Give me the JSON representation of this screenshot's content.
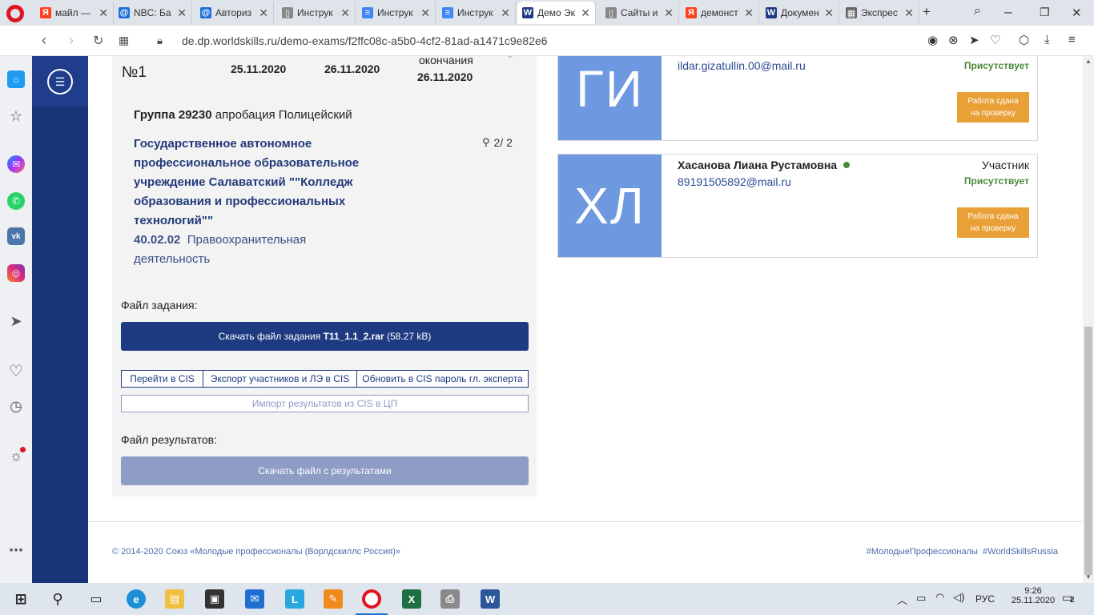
{
  "browser": {
    "tabs": [
      {
        "label": "майл —",
        "favicon_char": "Я",
        "favicon_color": "#fc3f1d"
      },
      {
        "label": "NBC: Ба",
        "favicon_char": "@",
        "favicon_color": "#1e6fd9"
      },
      {
        "label": "Авториз",
        "favicon_char": "@",
        "favicon_color": "#1e6fd9"
      },
      {
        "label": "Инструк",
        "favicon_char": "▯",
        "favicon_color": "#888888"
      },
      {
        "label": "Инструк",
        "favicon_char": "≡",
        "favicon_color": "#4285f4"
      },
      {
        "label": "Инструк",
        "favicon_char": "≡",
        "favicon_color": "#4285f4"
      },
      {
        "label": "Демо Эк",
        "favicon_char": "W",
        "favicon_color": "#1e3a80"
      },
      {
        "label": "Сайты и",
        "favicon_char": "▯",
        "favicon_color": "#888888"
      },
      {
        "label": "демонст",
        "favicon_char": "Я",
        "favicon_color": "#fc3f1d"
      },
      {
        "label": "Докумен",
        "favicon_char": "W",
        "favicon_color": "#1e3a80"
      },
      {
        "label": "Экспрес",
        "favicon_char": "▦",
        "favicon_color": "#666666"
      }
    ],
    "url": "de.dp.worldskills.ru/demo-exams/f2ffc08c-a5b0-4cf2-81ad-a1471c9e82e6"
  },
  "exam": {
    "number": "№1",
    "start_date": "25.11.2020",
    "end_date": "26.11.2020",
    "end_label": "окончания",
    "end_date_2": "26.11.2020",
    "group_label": "Группа 29230",
    "group_desc": "апробация Полицейский",
    "institution": "Государственное автономное профессиональное образовательное учреждение Салаватский \"\"Колледж образования и профессиональных технологий\"\"",
    "participants_count": "2/ 2",
    "spec_code": "40.02.02",
    "spec_name": "Правоохранительная деятельность",
    "task_file_label": "Файл задания:",
    "download_task_prefix": "Скачать файл задания",
    "download_task_file": "T11_1.1_2.rar",
    "download_task_size": "(58.27 kB)",
    "btn_cis": "Перейти в CIS",
    "btn_export": "Экспорт участников и ЛЭ в CIS",
    "btn_update_pwd": "Обновить в CIS пароль гл. эксперта",
    "btn_import": "Импорт результатов из CIS в ЦП",
    "results_file_label": "Файл результатов:",
    "btn_download_results": "Скачать файл с результатами"
  },
  "participants": [
    {
      "initials": "ГИ",
      "name": "",
      "email": "ildar.gizatullin.00@mail.ru",
      "role": "",
      "status": "Присутствует",
      "work_btn_line1": "Работа сдана",
      "work_btn_line2": "на проверку"
    },
    {
      "initials": "ХЛ",
      "name": "Хасанова Лиана Рустамовна",
      "email": "89191505892@mail.ru",
      "role": "Участник",
      "status": "Присутствует",
      "work_btn_line1": "Работа сдана",
      "work_btn_line2": "на проверку"
    }
  ],
  "footer": {
    "copyright": "© 2014-2020 Союз «Молодые профессионалы (Ворлдскиллс Россия)»",
    "hashtags": "#МолодыеПрофессионалы  #WorldSkillsRussia"
  },
  "taskbar": {
    "lang": "РУС",
    "time": "9:26",
    "date": "25.11.2020",
    "notifications": "2"
  },
  "colors": {
    "nav_dark": "#1a3478",
    "primary_btn": "#1e3a80",
    "avatar_bg": "#6e98e0",
    "status_green": "#4a8a3a",
    "work_btn": "#e8a037"
  }
}
